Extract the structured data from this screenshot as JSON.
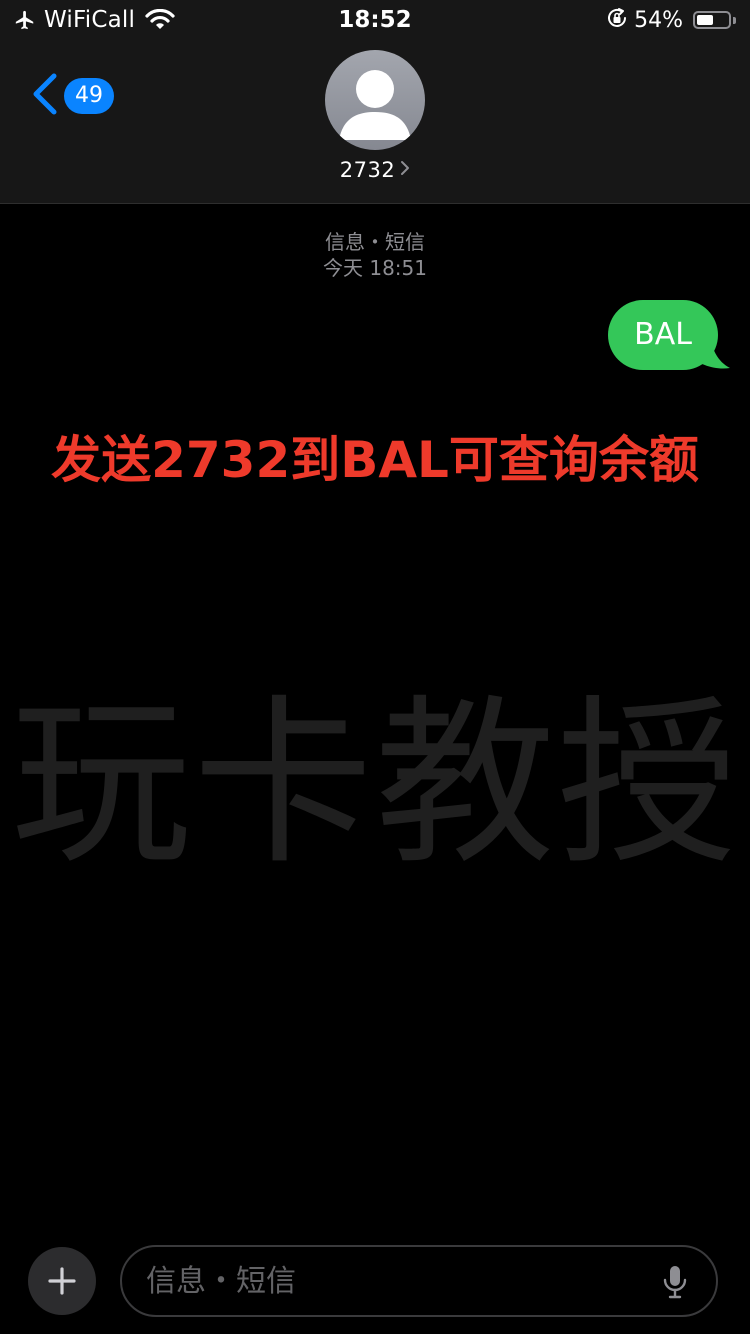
{
  "status_bar": {
    "carrier": "WiFiCall",
    "time": "18:52",
    "battery_percent_label": "54%",
    "battery_level": 0.54,
    "icons": [
      "airplane-icon",
      "wifi-icon",
      "orientation-lock-icon",
      "battery-icon"
    ]
  },
  "header": {
    "back_icon": "chevron-left-icon",
    "unread_count": "49",
    "contact_name": "2732",
    "avatar_icon": "person-silhouette-icon"
  },
  "conversation": {
    "service_label": "信息・短信",
    "timestamp": "今天 18:51",
    "messages": [
      {
        "direction": "outgoing",
        "text": "BAL",
        "color": "#34c759"
      }
    ]
  },
  "overlay": {
    "caption": "发送2732到BAL可查询余额",
    "caption_color": "#ee3a2b",
    "watermark": "玩卡教授"
  },
  "input_bar": {
    "add_icon": "plus-icon",
    "placeholder": "信息・短信",
    "value": "",
    "mic_icon": "microphone-icon"
  },
  "colors": {
    "accent": "#0a84ff",
    "header_background": "#171717",
    "background": "#000000"
  }
}
